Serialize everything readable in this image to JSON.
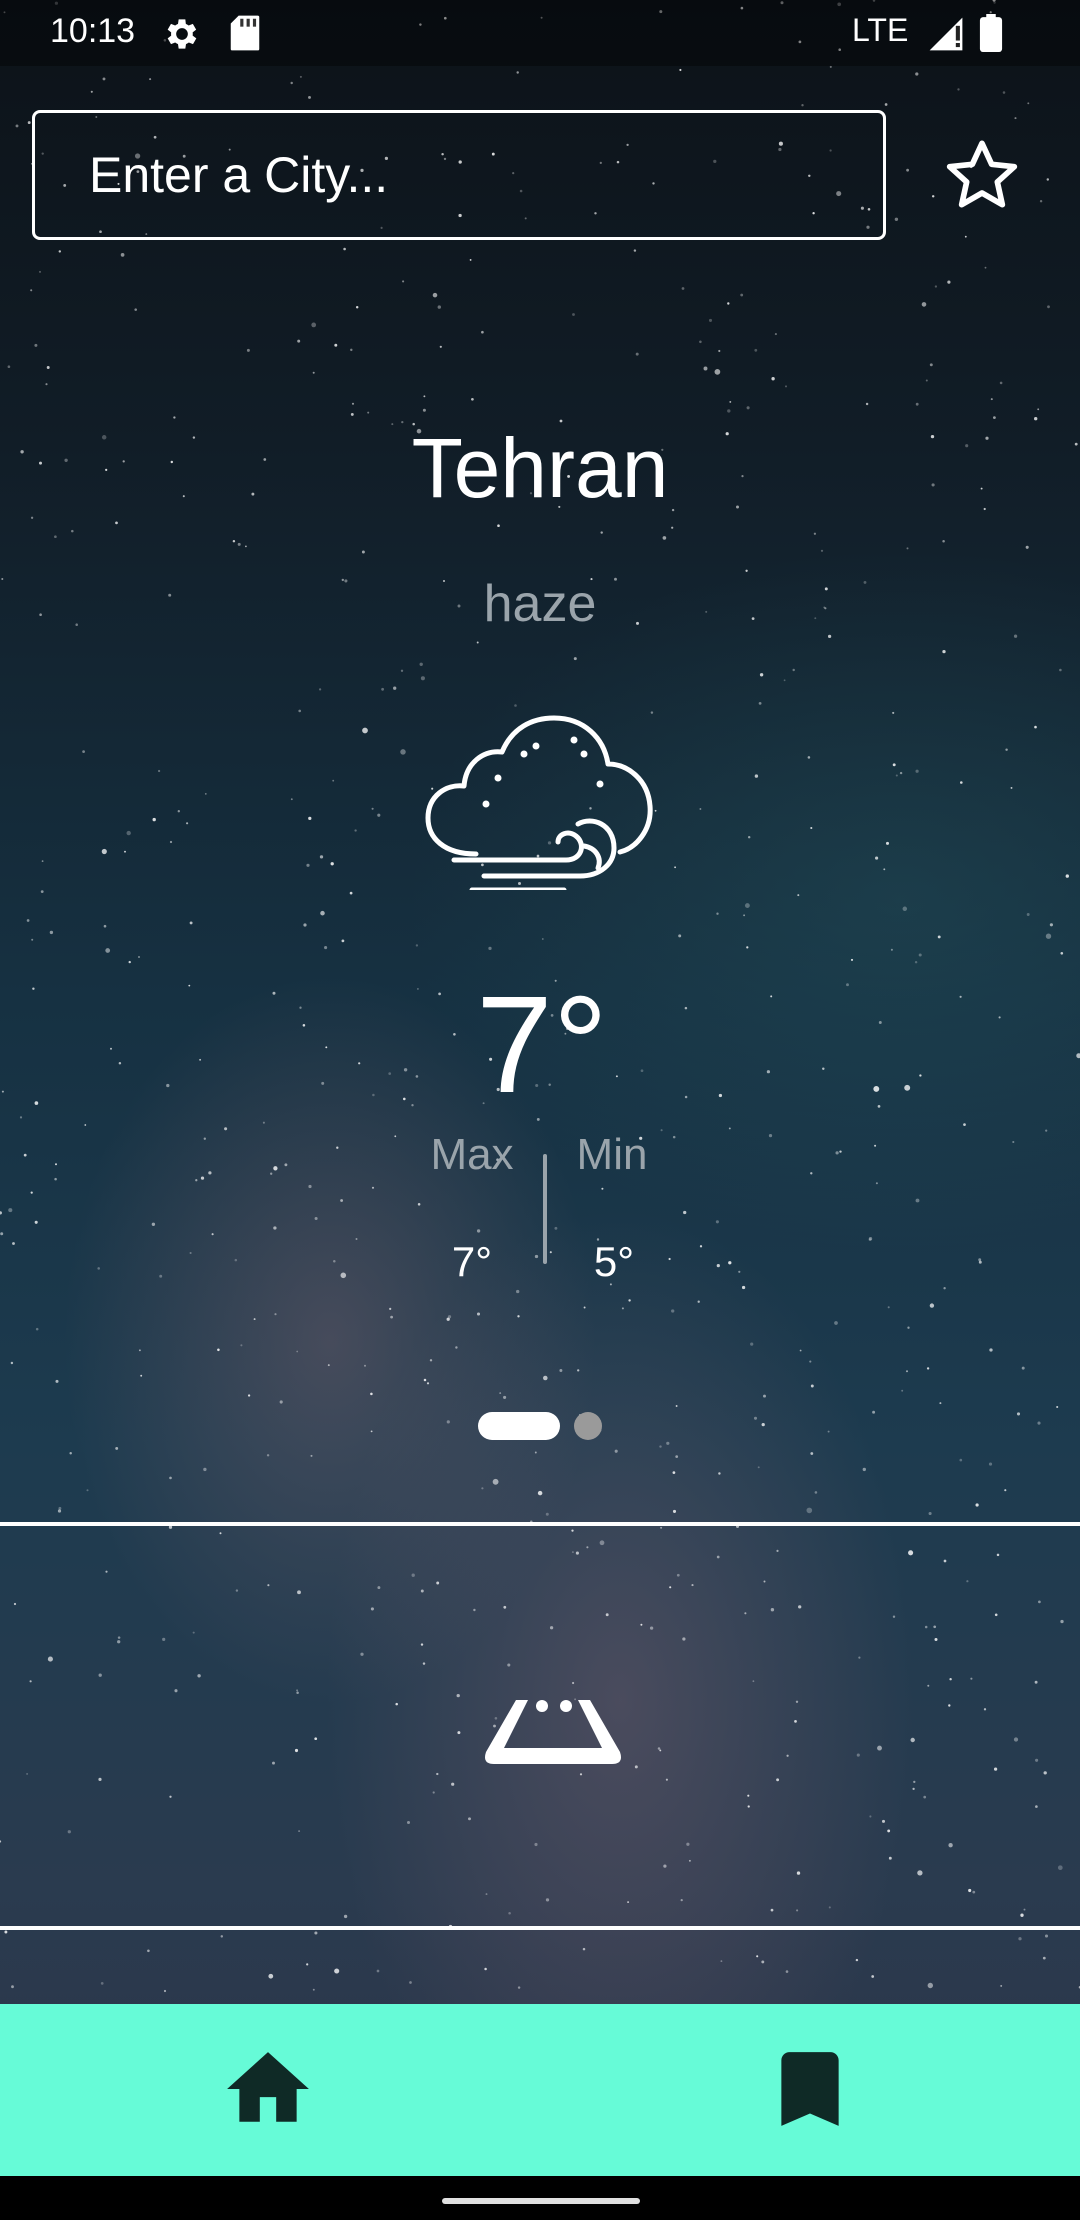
{
  "status_bar": {
    "time": "10:13",
    "network": "LTE",
    "icons": [
      "settings-icon",
      "sd-card-icon",
      "signal-icon",
      "battery-icon"
    ]
  },
  "search": {
    "placeholder": "Enter a City...",
    "favorite_icon": "star-outline-icon"
  },
  "weather": {
    "city": "Tehran",
    "condition": "haze",
    "icon": "cloud-wind-icon",
    "temperature": "7°",
    "max_label": "Max",
    "min_label": "Min",
    "max_value": "7°",
    "min_value": "5°"
  },
  "pager": {
    "pages": 2,
    "active_index": 0
  },
  "bottom_nav": {
    "items": [
      "home-icon",
      "bookmark-icon"
    ],
    "background": "#66fbd7"
  }
}
